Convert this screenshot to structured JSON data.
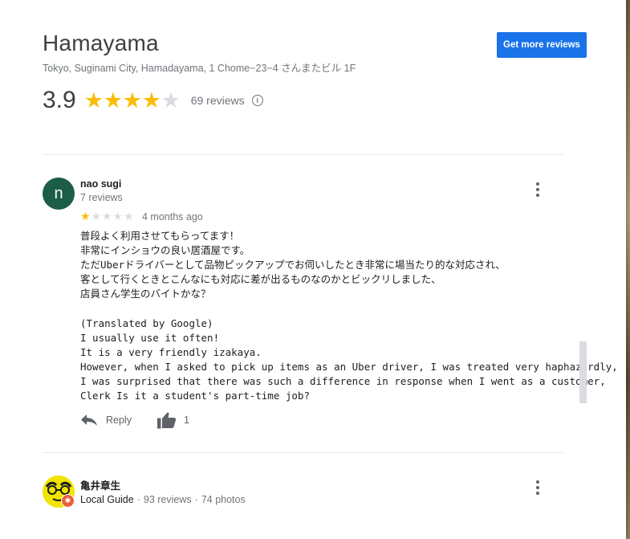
{
  "place": {
    "name": "Hamayama",
    "address": "Tokyo, Suginami City, Hamadayama, 1 Chome−23−4 さんまたビル 1F",
    "rating": "3.9",
    "stars_filled": 4,
    "stars_total": 5,
    "review_count": "69 reviews"
  },
  "actions": {
    "get_more_reviews": "Get more reviews"
  },
  "reviews": [
    {
      "avatar_letter": "n",
      "avatar_color": "#1b5e45",
      "name": "nao sugi",
      "subtitle": "7 reviews",
      "rating": 1,
      "date": "4 months ago",
      "text": "普段よく利用させてもらってます！\n非常にインショウの良い居酒屋です。\nただUberドライバーとして品物ピックアップでお伺いしたとき非常に場当たり的な対応され、\n客として行くときとこんなにも対応に差が出るものなのかとビックリしました、\n店員さん学生のバイトかな？\n\n(Translated by Google)\nI usually use it often!\nIt is a very friendly izakaya.\nHowever, when I asked to pick up items as an Uber driver, I was treated very haphazardly,\nI was surprised that there was such a difference in response when I went as a customer,\nClerk Is it a student's part-time job?",
      "reply_label": "Reply",
      "likes": "1"
    },
    {
      "name": "亀井章生",
      "local_guide": "Local Guide",
      "reviews": "93 reviews",
      "photos": "74 photos",
      "separator": "·"
    }
  ],
  "colors": {
    "accent": "#1a73e8",
    "star": "#fbbc04",
    "star_empty": "#dadce0"
  }
}
